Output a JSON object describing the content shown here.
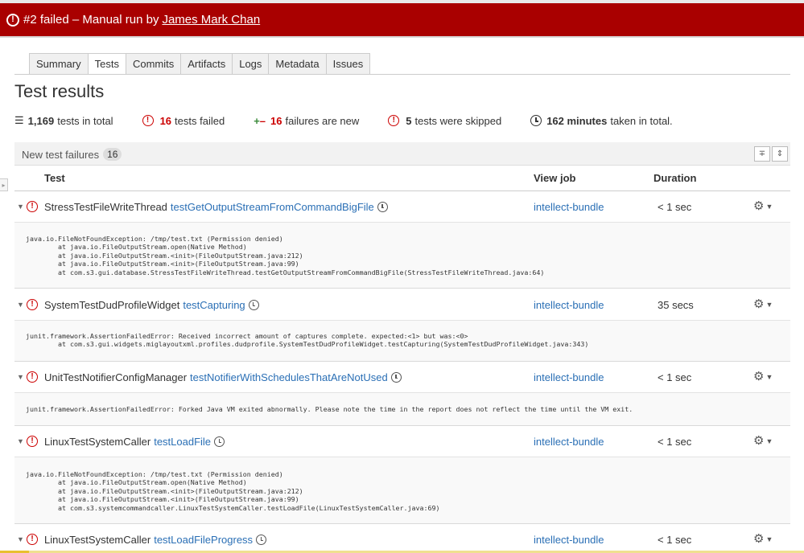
{
  "banner": {
    "icon": "warning-circle-icon",
    "text": "#2 failed – Manual run by",
    "user": "James Mark Chan",
    "color": "#a90000"
  },
  "tabs": [
    {
      "label": "Summary",
      "active": false
    },
    {
      "label": "Tests",
      "active": true
    },
    {
      "label": "Commits",
      "active": false
    },
    {
      "label": "Artifacts",
      "active": false
    },
    {
      "label": "Logs",
      "active": false
    },
    {
      "label": "Metadata",
      "active": false
    },
    {
      "label": "Issues",
      "active": false
    }
  ],
  "page_title": "Test results",
  "stats": {
    "total_value": "1,169",
    "total_label": "tests in total",
    "failed_value": "16",
    "failed_label": "tests failed",
    "new_value": "16",
    "new_label": "failures are new",
    "skipped_value": "5",
    "skipped_label": "tests were skipped",
    "time_value": "162 minutes",
    "time_label": "taken in total."
  },
  "section": {
    "title": "New test failures",
    "count": "16"
  },
  "columns": {
    "test": "Test",
    "view_job": "View job",
    "duration": "Duration"
  },
  "rows": [
    {
      "class": "StressTestFileWriteThread",
      "method": "testGetOutputStreamFromCommandBigFile",
      "job": "intellect-bundle",
      "duration": "< 1 sec",
      "stack": "java.io.FileNotFoundException: /tmp/test.txt (Permission denied)\n\tat java.io.FileOutputStream.open(Native Method)\n\tat java.io.FileOutputStream.<init>(FileOutputStream.java:212)\n\tat java.io.FileOutputStream.<init>(FileOutputStream.java:99)\n\tat com.s3.gui.database.StressTestFileWriteThread.testGetOutputStreamFromCommandBigFile(StressTestFileWriteThread.java:64)"
    },
    {
      "class": "SystemTestDudProfileWidget",
      "method": "testCapturing",
      "job": "intellect-bundle",
      "duration": "35 secs",
      "stack": "junit.framework.AssertionFailedError: Received incorrect amount of captures complete. expected:<1> but was:<0>\n\tat com.s3.gui.widgets.miglayoutxml.profiles.dudprofile.SystemTestDudProfileWidget.testCapturing(SystemTestDudProfileWidget.java:343)"
    },
    {
      "class": "UnitTestNotifierConfigManager",
      "method": "testNotifierWithSchedulesThatAreNotUsed",
      "job": "intellect-bundle",
      "duration": "< 1 sec",
      "stack": "junit.framework.AssertionFailedError: Forked Java VM exited abnormally. Please note the time in the report does not reflect the time until the VM exit."
    },
    {
      "class": "LinuxTestSystemCaller",
      "method": "testLoadFile",
      "job": "intellect-bundle",
      "duration": "< 1 sec",
      "stack": "java.io.FileNotFoundException: /tmp/test.txt (Permission denied)\n\tat java.io.FileOutputStream.open(Native Method)\n\tat java.io.FileOutputStream.<init>(FileOutputStream.java:212)\n\tat java.io.FileOutputStream.<init>(FileOutputStream.java:99)\n\tat com.s3.systemcommandcaller.LinuxTestSystemCaller.testLoadFile(LinuxTestSystemCaller.java:69)"
    },
    {
      "class": "LinuxTestSystemCaller",
      "method": "testLoadFileProgress",
      "job": "intellect-bundle",
      "duration": "< 1 sec"
    }
  ]
}
